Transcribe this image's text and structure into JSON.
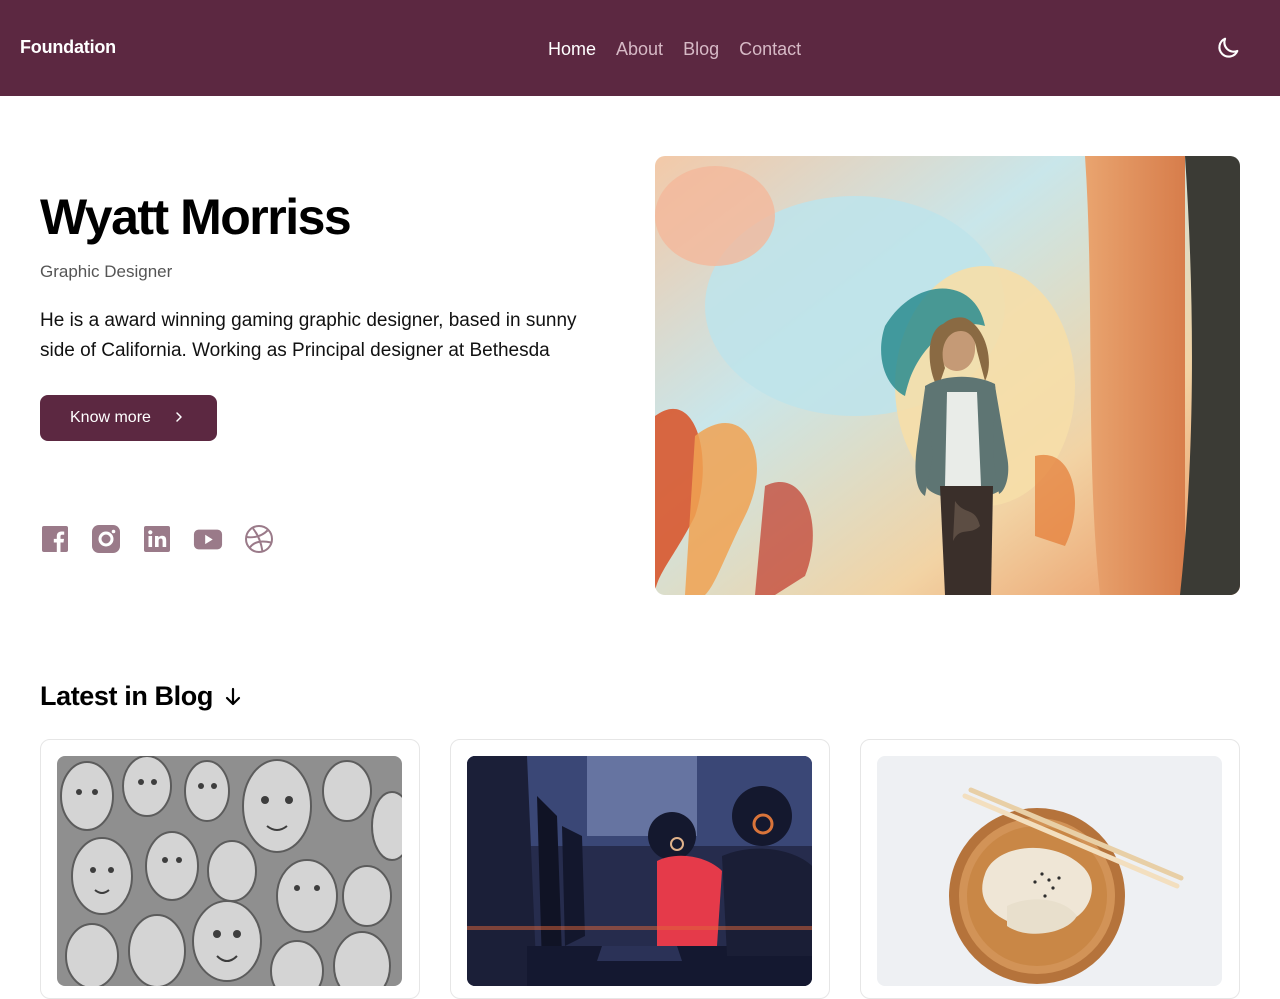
{
  "header": {
    "brand": "Foundation",
    "nav": [
      {
        "label": "Home",
        "active": true
      },
      {
        "label": "About",
        "active": false
      },
      {
        "label": "Blog",
        "active": false
      },
      {
        "label": "Contact",
        "active": false
      }
    ],
    "theme_icon": "moon-icon"
  },
  "hero": {
    "name": "Wyatt Morriss",
    "role": "Graphic Designer",
    "bio": "He is a award winning gaming graphic designer, based in sunny side of California. Working as Principal designer at Bethesda",
    "cta_label": "Know more",
    "photo_alt": "man-before-colorful-mural"
  },
  "socials": [
    "facebook-icon",
    "instagram-icon",
    "linkedin-icon",
    "youtube-icon",
    "dribbble-icon"
  ],
  "blog": {
    "heading": "Latest in Blog",
    "cards": [
      {
        "image": "carved-faces-sculpture"
      },
      {
        "image": "gamers-at-computers"
      },
      {
        "image": "dumplings-wooden-plate"
      }
    ]
  },
  "colors": {
    "brand": "#5c2841",
    "nav_inactive": "#d6b9c5",
    "social_icon": "#9a7a89"
  }
}
